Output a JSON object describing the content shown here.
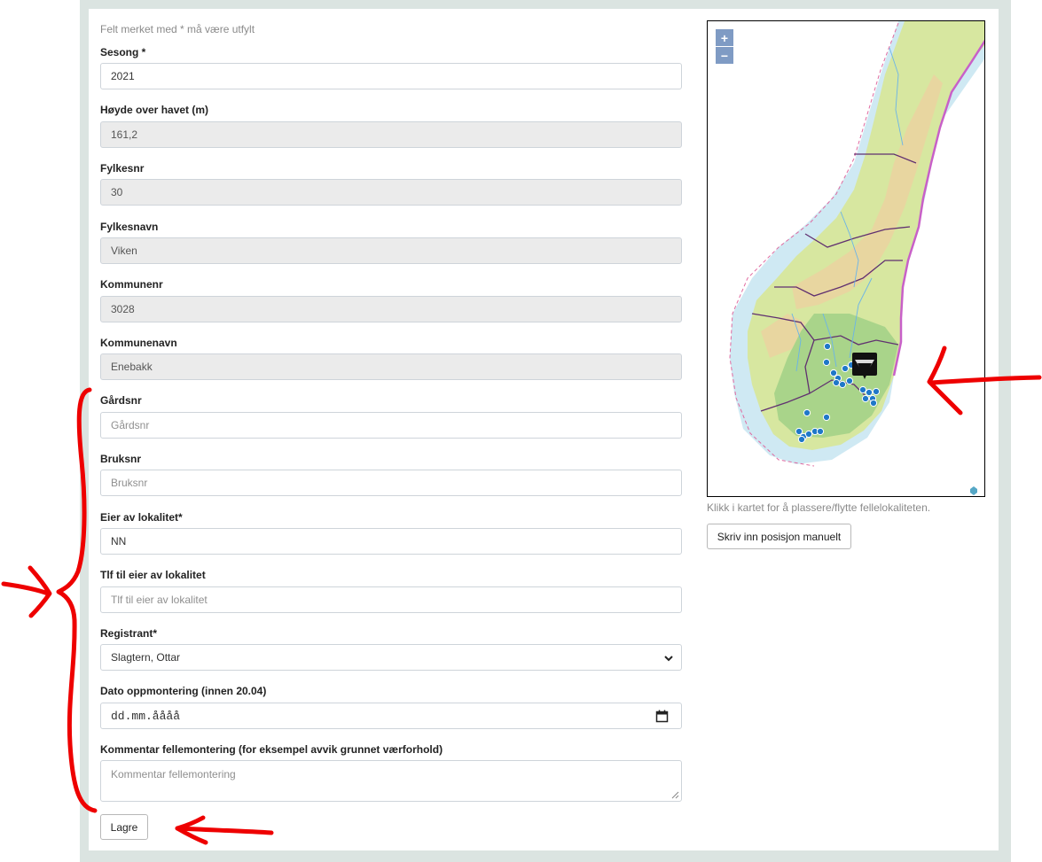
{
  "form": {
    "required_note": "Felt merket med * må være utfylt",
    "fields": [
      {
        "label": "Sesong *",
        "value": "2021",
        "placeholder": ""
      },
      {
        "label": "Høyde over havet (m)",
        "value": "161,2",
        "placeholder": ""
      },
      {
        "label": "Fylkesnr",
        "value": "30",
        "placeholder": ""
      },
      {
        "label": "Fylkesnavn",
        "value": "Viken",
        "placeholder": ""
      },
      {
        "label": "Kommunenr",
        "value": "3028",
        "placeholder": ""
      },
      {
        "label": "Kommunenavn",
        "value": "Enebakk",
        "placeholder": ""
      },
      {
        "label": "Gårdsnr",
        "value": "",
        "placeholder": "Gårdsnr"
      },
      {
        "label": "Bruksnr",
        "value": "",
        "placeholder": "Bruksnr"
      },
      {
        "label": "Eier av lokalitet*",
        "value": "NN",
        "placeholder": ""
      },
      {
        "label": "Tlf til eier av lokalitet",
        "value": "",
        "placeholder": "Tlf til eier av lokalitet"
      },
      {
        "label": "Registrant*",
        "value": "Slagtern, Ottar",
        "placeholder": ""
      },
      {
        "label": "Dato oppmontering (innen 20.04)",
        "value": "dd.mm.åååå",
        "placeholder": ""
      },
      {
        "label": "Kommentar fellemontering (for eksempel avvik grunnet værforhold)",
        "value": "",
        "placeholder": "Kommentar fellemontering"
      }
    ],
    "save_label": "Lagre"
  },
  "map": {
    "zoom_in": "+",
    "zoom_out": "−",
    "hint": "Klikk i kartet for å plassere/flytte fellelokaliteten.",
    "manual_button": "Skriv inn posisjon manuelt"
  },
  "colors": {
    "frame": "#dbe4e1",
    "annotation": "#ee0000",
    "map_marker": "#1f78c8"
  }
}
